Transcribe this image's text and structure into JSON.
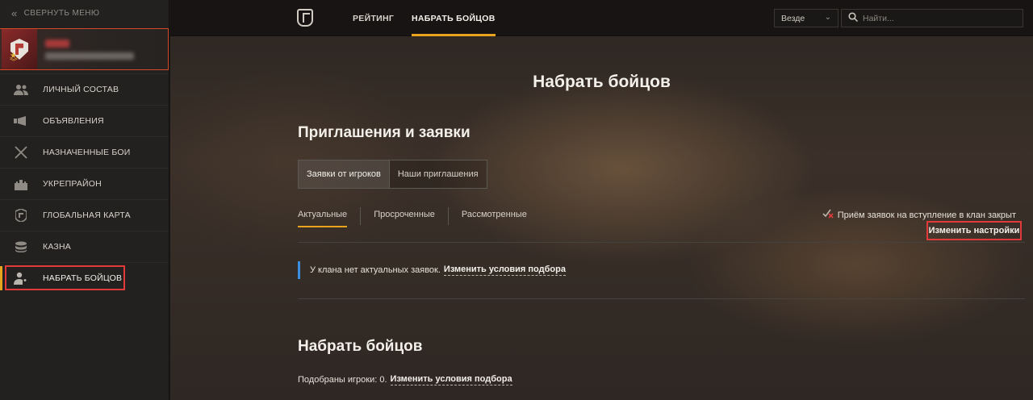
{
  "sidebar": {
    "collapse_label": "СВЕРНУТЬ МЕНЮ",
    "items": [
      {
        "label": "ЛИЧНЫЙ СОСТАВ",
        "icon": "people-icon"
      },
      {
        "label": "ОБЪЯВЛЕНИЯ",
        "icon": "megaphone-icon"
      },
      {
        "label": "НАЗНАЧЕННЫЕ БОИ",
        "icon": "crossed-swords-icon"
      },
      {
        "label": "УКРЕПРАЙОН",
        "icon": "fortress-icon"
      },
      {
        "label": "ГЛОБАЛЬНАЯ КАРТА",
        "icon": "global-map-shield-icon"
      },
      {
        "label": "КАЗНА",
        "icon": "coins-icon"
      },
      {
        "label": "НАБРАТЬ БОЙЦОВ",
        "icon": "add-user-icon",
        "active": true
      }
    ]
  },
  "topnav": {
    "tabs": [
      {
        "label": "РЕЙТИНГ"
      },
      {
        "label": "НАБРАТЬ БОЙЦОВ",
        "active": true
      }
    ],
    "scope_value": "Везде",
    "search_placeholder": "Найти..."
  },
  "page": {
    "title": "Набрать бойцов",
    "invites_section_title": "Приглашения и заявки",
    "segments": [
      "Заявки от игроков",
      "Наши приглашения"
    ],
    "subtabs": [
      "Актуальные",
      "Просроченные",
      "Рассмотренные"
    ],
    "recruit_status": "Приём заявок на вступление в клан закрыт",
    "change_settings": "Изменить настройки",
    "notice_text": "У клана нет актуальных заявок.",
    "notice_link": "Изменить условия подбора",
    "recruit_section_title": "Набрать бойцов",
    "picked_text": "Подобраны игроки: 0.",
    "picked_link": "Изменить условия подбора"
  },
  "colors": {
    "accent": "#e8a41c",
    "highlight": "#e03a3a",
    "info": "#3b8fe0"
  }
}
